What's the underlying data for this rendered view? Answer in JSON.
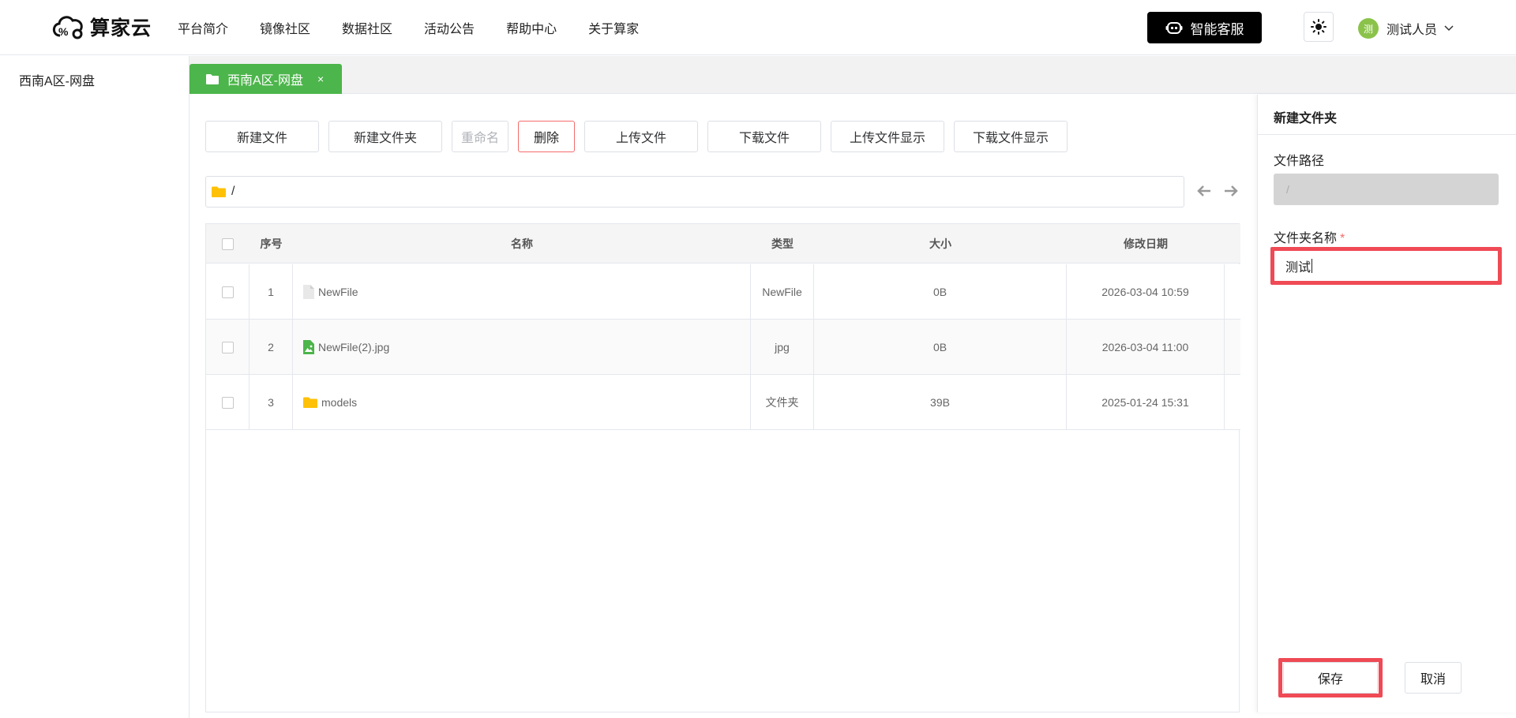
{
  "header": {
    "brand": "算家云",
    "nav": [
      "平台简介",
      "镜像社区",
      "数据社区",
      "活动公告",
      "帮助中心",
      "关于算家"
    ],
    "service_label": "智能客服",
    "user": {
      "avatar_text": "测",
      "name": "测试人员"
    }
  },
  "sidebar": {
    "items": [
      {
        "label": "西南A区-网盘"
      }
    ]
  },
  "tab": {
    "label": "西南A区-网盘",
    "close": "×"
  },
  "toolbar": {
    "new_file": "新建文件",
    "new_folder": "新建文件夹",
    "rename": "重命名",
    "delete": "删除",
    "upload": "上传文件",
    "download": "下载文件",
    "upload_display": "上传文件显示",
    "download_display": "下载文件显示"
  },
  "path": {
    "value": "/"
  },
  "table": {
    "headers": {
      "index": "序号",
      "name": "名称",
      "type": "类型",
      "size": "大小",
      "modified": "修改日期"
    },
    "rows": [
      {
        "index": "1",
        "name": "NewFile",
        "type": "NewFile",
        "size": "0B",
        "modified": "2026-03-04 10:59",
        "icon": "file-icon"
      },
      {
        "index": "2",
        "name": "NewFile(2).jpg",
        "type": "jpg",
        "size": "0B",
        "modified": "2026-03-04 11:00",
        "icon": "image-file-icon"
      },
      {
        "index": "3",
        "name": "models",
        "type": "文件夹",
        "size": "39B",
        "modified": "2025-01-24 15:31",
        "icon": "folder-icon"
      }
    ]
  },
  "panel": {
    "title": "新建文件夹",
    "path_label": "文件路径",
    "path_value": "/",
    "name_label": "文件夹名称",
    "required_mark": "*",
    "name_value": "测试",
    "save": "保存",
    "cancel": "取消"
  },
  "colors": {
    "accent": "#4cb54b",
    "danger": "#f56c6c",
    "highlight": "#ef4a55",
    "folder": "#ffc107"
  }
}
